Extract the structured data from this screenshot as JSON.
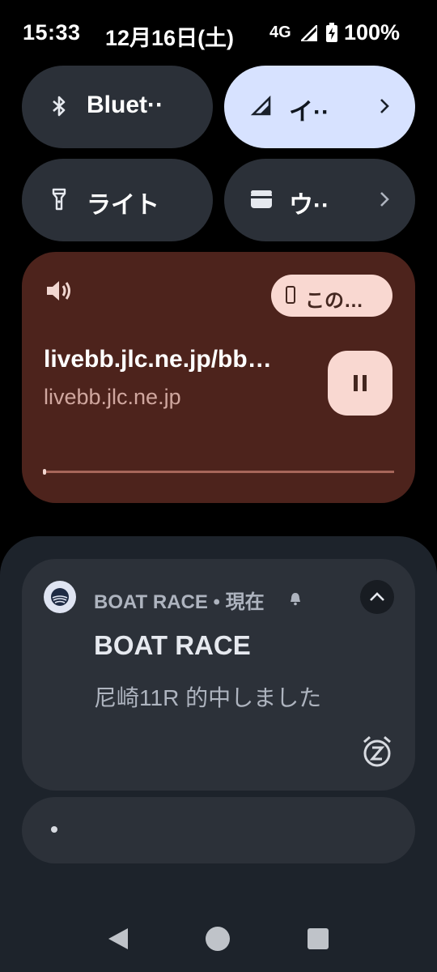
{
  "status_bar": {
    "time": "15:33",
    "date": "12月16日(土)",
    "network": "4G",
    "battery": "100%"
  },
  "quick_tiles": [
    {
      "label": "Bluet··",
      "icon": "bluetooth-icon",
      "active": false
    },
    {
      "label": "イ··",
      "icon": "signal-icon",
      "active": true
    },
    {
      "label": "ライト",
      "icon": "flashlight-icon",
      "active": false
    },
    {
      "label": "ウ··",
      "icon": "wallet-icon",
      "active": false
    }
  ],
  "media": {
    "output_device": "この…",
    "title": "livebb.jlc.ne.jp/bb…",
    "subtitle": "livebb.jlc.ne.jp",
    "progress": 0.0
  },
  "notification": {
    "header": "BOAT RACE • 現在",
    "title": "BOAT RACE",
    "text": "尼崎11R 的中しました"
  },
  "colors": {
    "tile_bg": "#2b3038",
    "tile_active_bg": "#d7e2ff",
    "media_bg": "#4d231c",
    "media_accent": "#f9d8d1",
    "shade_bg": "#1d232b",
    "notification_bg": "#2c3139"
  }
}
